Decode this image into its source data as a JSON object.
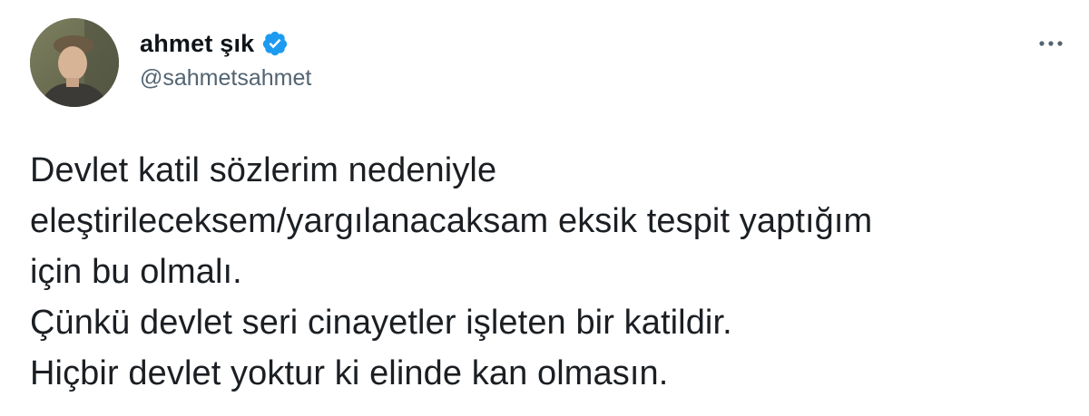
{
  "author": {
    "display_name": "ahmet şık",
    "handle": "@sahmetsahmet",
    "verified": true,
    "verified_color": "#1d9bf0"
  },
  "tweet": {
    "lines": [
      "Devlet katil sözlerim nedeniyle",
      "eleştirileceksem/yargılanacaksam eksik tespit yaptığım",
      "için bu olmalı.",
      "Çünkü devlet seri cinayetler işleten bir katildir.",
      "Hiçbir devlet yoktur ki elinde kan olmasın."
    ]
  },
  "icons": {
    "avatar": "profile-photo",
    "verified": "verified-badge-icon",
    "more": "more-horizontal-icon"
  }
}
